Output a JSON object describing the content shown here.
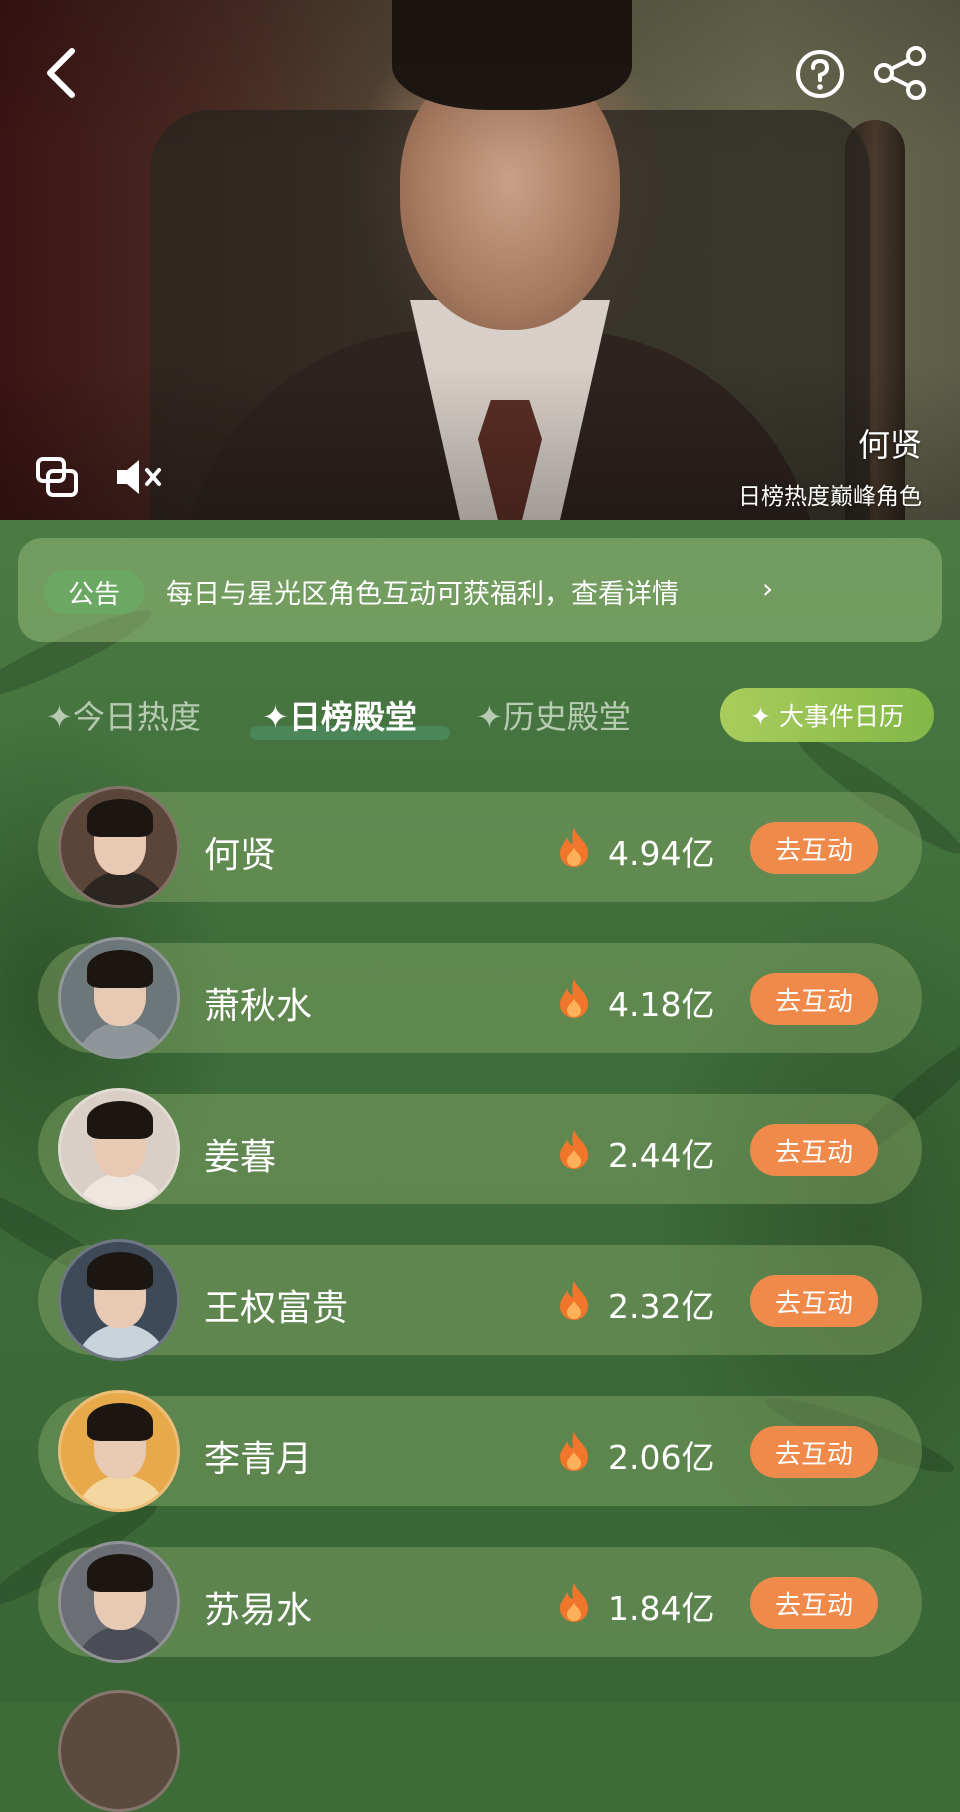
{
  "hero": {
    "character_name": "何贤",
    "subtitle": "日榜热度巅峰角色"
  },
  "icons": {
    "back": "back-arrow-icon",
    "help": "help-circle-icon",
    "share": "share-icon",
    "pip": "picture-in-picture-icon",
    "mute": "mute-icon",
    "flame": "flame-icon"
  },
  "notice": {
    "badge": "公告",
    "text": "每日与星光区角色互动可获福利，查看详情",
    "arrow": "›"
  },
  "tabs": [
    {
      "label": "✦今日热度",
      "active": false
    },
    {
      "label": "✦日榜殿堂",
      "active": true
    },
    {
      "label": "✦历史殿堂",
      "active": false
    }
  ],
  "calendar_button": "✦ 大事件日历",
  "ranking": [
    {
      "name": "何贤",
      "heat": "4.94亿",
      "action": "去互动"
    },
    {
      "name": "萧秋水",
      "heat": "4.18亿",
      "action": "去互动"
    },
    {
      "name": "姜暮",
      "heat": "2.44亿",
      "action": "去互动"
    },
    {
      "name": "王权富贵",
      "heat": "2.32亿",
      "action": "去互动"
    },
    {
      "name": "李青月",
      "heat": "2.06亿",
      "action": "去互动"
    },
    {
      "name": "苏易水",
      "heat": "1.84亿",
      "action": "去互动"
    }
  ],
  "colors": {
    "background": "#3f6b39",
    "action_button": "#f08a4b",
    "notice_badge": "#6ba863",
    "calendar_button": "#9cc655",
    "flame": "#f0762c"
  }
}
